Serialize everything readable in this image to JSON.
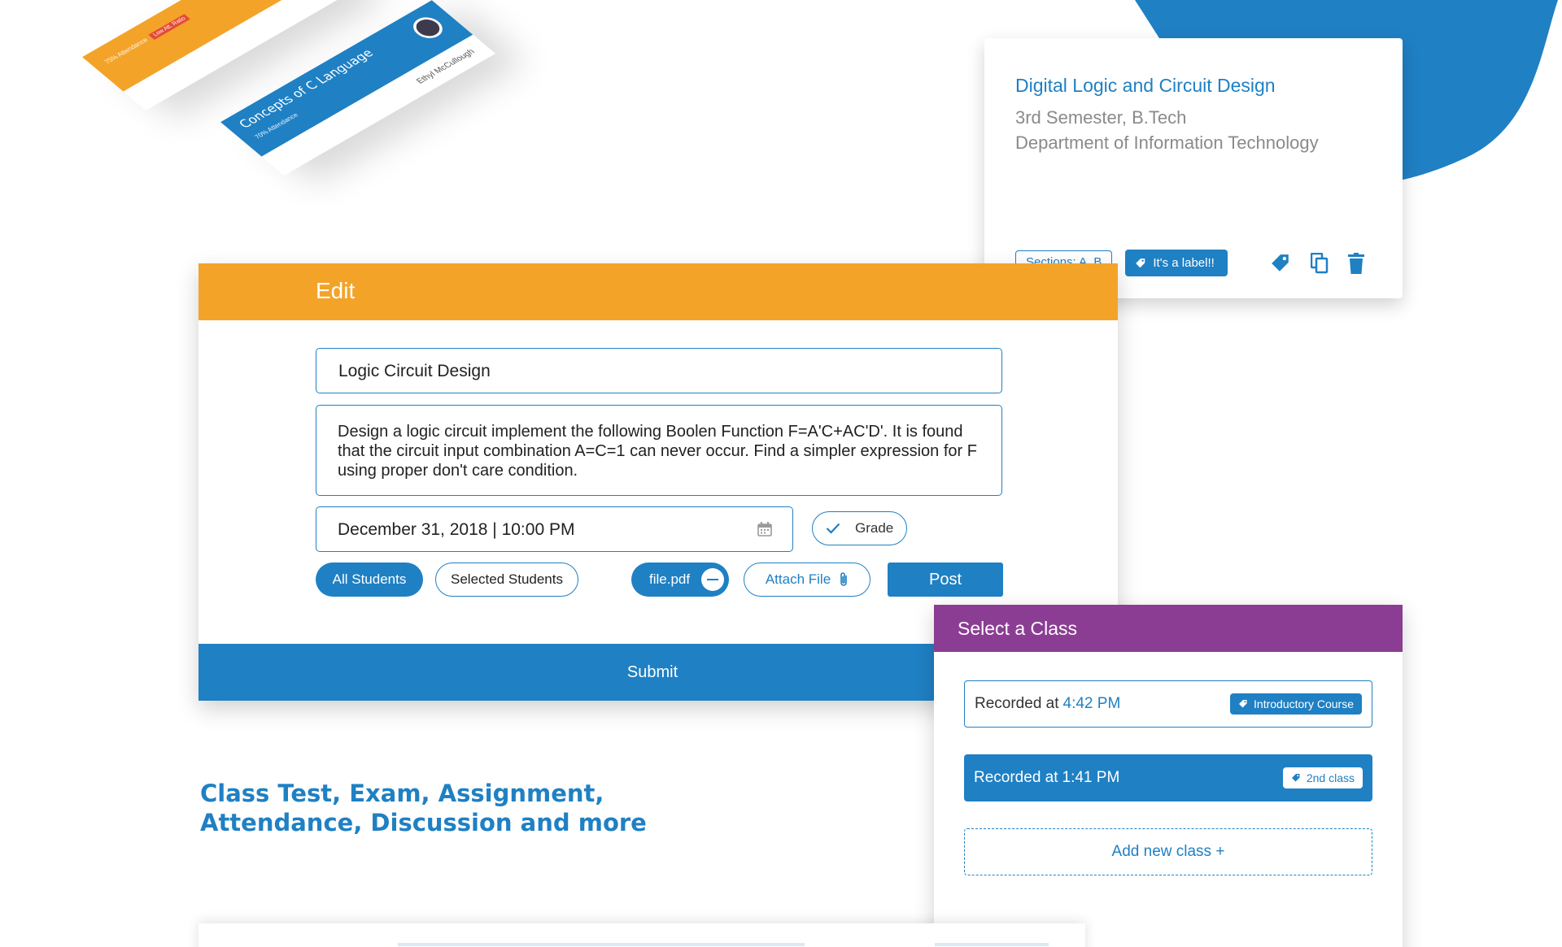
{
  "colors": {
    "primary": "#1f80c4",
    "accent_orange": "#f4a329",
    "purple": "#8b3d93"
  },
  "tilted_cards": [
    {
      "title": "",
      "subtitle": "75% Attendance",
      "badge": "Low Att. Ratio",
      "color": "orange"
    },
    {
      "title": "Concepts of C Language",
      "subtitle": "70% Attendance",
      "teacher": "Ethyl McCullough",
      "color": "blue"
    }
  ],
  "course_card": {
    "title": "Digital Logic and Circuit Design",
    "semester": "3rd Semester, B.Tech",
    "department": "Department of Information Technology",
    "sections_chip": "Sections: A, B",
    "label_chip": "It's a label!!",
    "icons": [
      "tag-icon",
      "copy-icon",
      "trash-icon"
    ]
  },
  "edit_panel": {
    "header": "Edit",
    "title_value": "Logic Circuit Design",
    "description": "Design a logic circuit implement the following Boolen Function F=A'C+AC'D'. It is found that the circuit input combination A=C=1 can never occur. Find a simpler expression for F using proper don't care condition.",
    "due_date": "December 31, 2018 | 10:00 PM",
    "grade_label": "Grade",
    "all_students": "All Students",
    "selected_students": "Selected Students",
    "file_name": "file.pdf",
    "attach_label": "Attach File",
    "post_label": "Post",
    "submit_label": "Submit"
  },
  "feature_heading": {
    "line1": "Class Test, Exam, Assignment,",
    "line2": "Attendance, Discussion and more"
  },
  "class_panel": {
    "header": "Select a Class",
    "rows": [
      {
        "prefix": "Recorded at",
        "time": "4:42 PM",
        "tag": "Introductory Course"
      },
      {
        "prefix": "Recorded at",
        "time": "1:41 PM",
        "tag": "2nd class"
      }
    ],
    "add_label": "Add new class +"
  }
}
